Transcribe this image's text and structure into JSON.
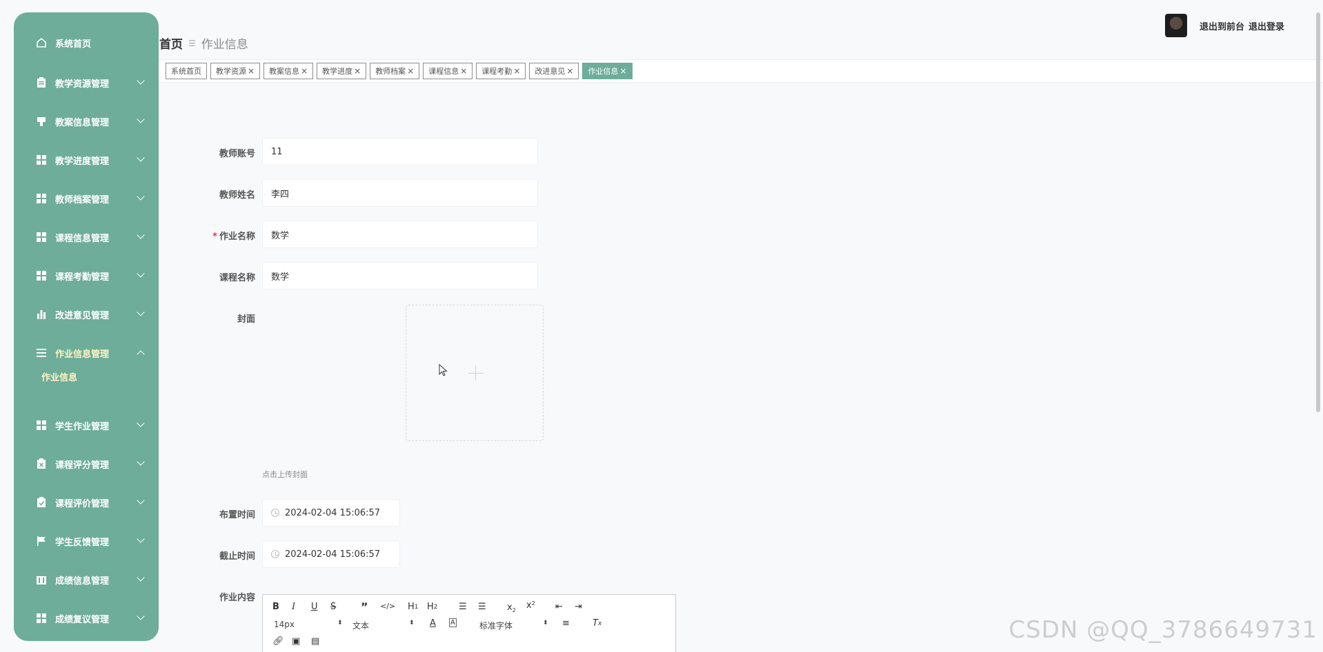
{
  "sidebar": {
    "items": [
      {
        "label": "系统首页",
        "icon": "home-icon"
      },
      {
        "label": "教学资源管理",
        "icon": "clipboard-icon"
      },
      {
        "label": "教案信息管理",
        "icon": "bookmark-icon"
      },
      {
        "label": "教学进度管理",
        "icon": "grid-icon"
      },
      {
        "label": "教师档案管理",
        "icon": "grid-icon"
      },
      {
        "label": "课程信息管理",
        "icon": "grid-icon"
      },
      {
        "label": "课程考勤管理",
        "icon": "grid-icon"
      },
      {
        "label": "改进意见管理",
        "icon": "bar-chart-icon"
      },
      {
        "label": "作业信息管理",
        "icon": "menu-icon"
      },
      {
        "label": "学生作业管理",
        "icon": "grid-icon"
      },
      {
        "label": "课程评分管理",
        "icon": "clipboard-x-icon"
      },
      {
        "label": "课程评价管理",
        "icon": "clipboard-check-icon"
      },
      {
        "label": "学生反馈管理",
        "icon": "flag-icon"
      },
      {
        "label": "成绩信息管理",
        "icon": "building-icon"
      },
      {
        "label": "成绩复议管理",
        "icon": "grid-icon"
      }
    ],
    "sub_item": "作业信息"
  },
  "header": {
    "breadcrumb_home": "首页",
    "breadcrumb_current": "作业信息",
    "link_front": "退出到前台",
    "link_logout": "退出登录"
  },
  "tabs": [
    {
      "label": "系统首页",
      "closable": false
    },
    {
      "label": "教学资源",
      "closable": true
    },
    {
      "label": "教案信息",
      "closable": true
    },
    {
      "label": "教学进度",
      "closable": true
    },
    {
      "label": "教师档案",
      "closable": true
    },
    {
      "label": "课程信息",
      "closable": true
    },
    {
      "label": "课程考勤",
      "closable": true
    },
    {
      "label": "改进意见",
      "closable": true
    },
    {
      "label": "作业信息",
      "closable": true,
      "active": true
    }
  ],
  "form": {
    "teacher_account_label": "教师账号",
    "teacher_account_value": "11",
    "teacher_name_label": "教师姓名",
    "teacher_name_value": "李四",
    "assignment_name_label": "作业名称",
    "assignment_name_value": "数学",
    "course_name_label": "课程名称",
    "course_name_value": "数学",
    "cover_label": "封面",
    "cover_tip": "点击上传封面",
    "assign_time_label": "布置时间",
    "assign_time_value": "2024-02-04 15:06:57",
    "deadline_label": "截止时间",
    "deadline_value": "2024-02-04 15:06:57",
    "content_label": "作业内容"
  },
  "editor": {
    "font_size": "14px",
    "text_type": "文本",
    "font_family": "标准字体"
  },
  "watermark": "CSDN @QQ_3786649731",
  "colors": {
    "sidebar": "#6dad99",
    "active_tab": "#6dad99",
    "active_text": "#fff3c4"
  }
}
